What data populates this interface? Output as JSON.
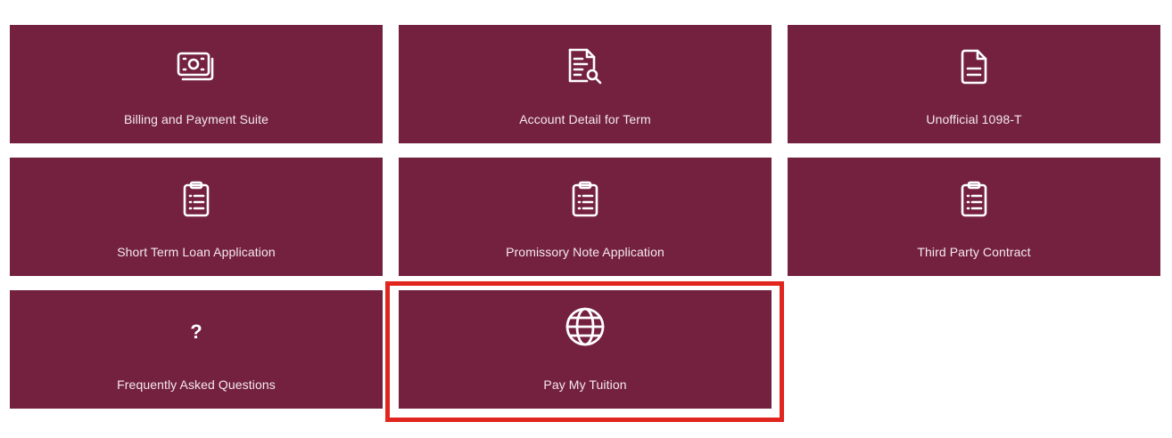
{
  "tiles": [
    {
      "label": "Billing and Payment Suite",
      "icon": "money-icon"
    },
    {
      "label": "Account Detail for Term",
      "icon": "document-search-icon"
    },
    {
      "label": "Unofficial 1098-T",
      "icon": "document-icon"
    },
    {
      "label": "Short Term Loan Application",
      "icon": "clipboard-list-icon"
    },
    {
      "label": "Promissory Note Application",
      "icon": "clipboard-list-icon"
    },
    {
      "label": "Third Party Contract",
      "icon": "clipboard-list-icon"
    },
    {
      "label": "Frequently Asked Questions",
      "icon": "question-icon",
      "glyph": "?"
    },
    {
      "label": "Pay My Tuition",
      "icon": "globe-icon"
    }
  ],
  "colors": {
    "tile_background": "#74213f",
    "highlight": "#e0261e"
  }
}
